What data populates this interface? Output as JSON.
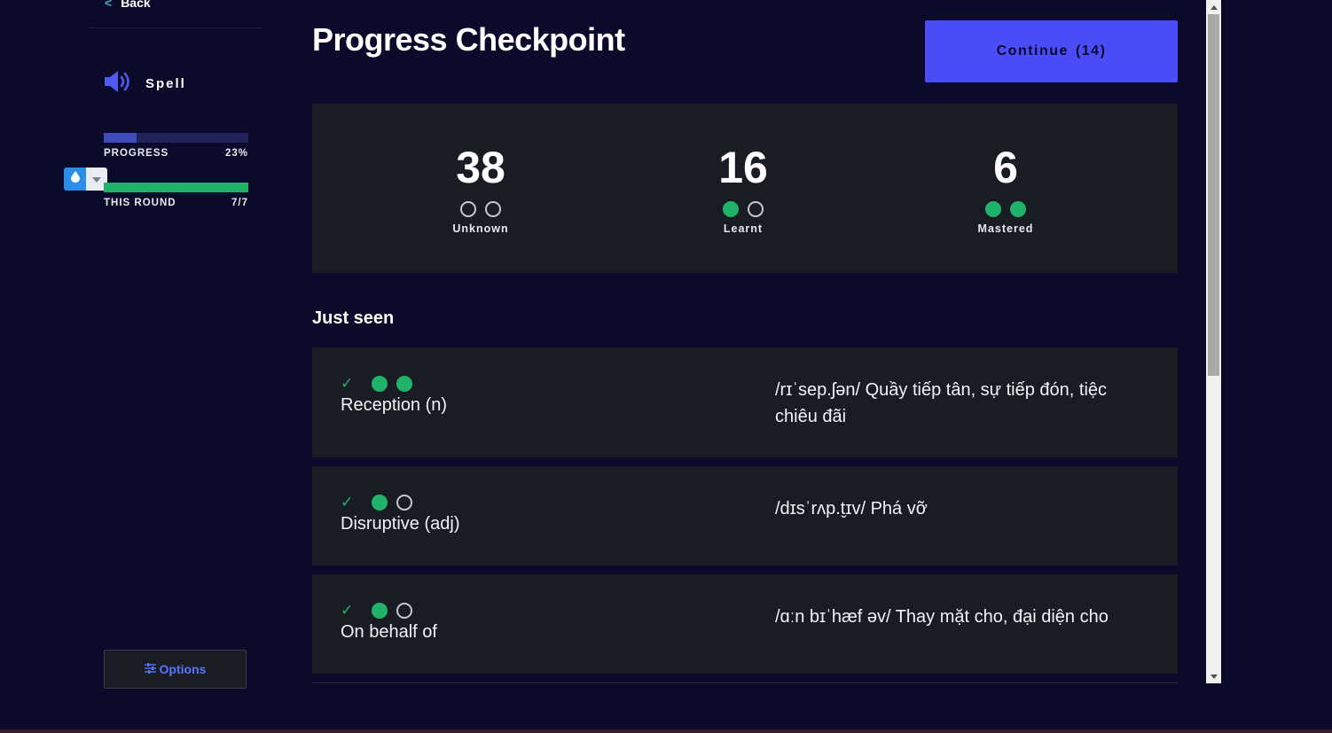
{
  "sidebar": {
    "back_label": "Back",
    "mode_label": "Spell",
    "progress": {
      "label": "PROGRESS",
      "value_text": "23%",
      "fraction": 0.23,
      "color": "#3e4bb8"
    },
    "round": {
      "label": "THIS ROUND",
      "value_text": "7/7",
      "fraction": 1.0,
      "color": "#21b36a"
    },
    "options_label": "Options"
  },
  "header": {
    "title": "Progress Checkpoint",
    "continue_label": "Continue",
    "continue_count": "(14)"
  },
  "stats": [
    {
      "number": "38",
      "label": "Unknown",
      "filled_dots": 0
    },
    {
      "number": "16",
      "label": "Learnt",
      "filled_dots": 1
    },
    {
      "number": "6",
      "label": "Mastered",
      "filled_dots": 2
    }
  ],
  "just_seen": {
    "title": "Just seen",
    "items": [
      {
        "term": "Reception (n)",
        "definition": "/rɪˈsep.ʃən/ Quầy tiếp tân, sự tiếp đón, tiệc chiêu đãi",
        "filled_dots": 2
      },
      {
        "term": "Disruptive (adj)",
        "definition": "/dɪsˈrʌp.t̬ɪv/ Phá vỡ",
        "filled_dots": 1
      },
      {
        "term": "On behalf of",
        "definition": "/ɑːn bɪˈhæf əv/ Thay mặt cho, đại diện cho",
        "filled_dots": 1
      }
    ]
  },
  "colors": {
    "background": "#0b0a2a",
    "panel": "#1a1c24",
    "accent": "#4a4cf7",
    "success": "#21b36a"
  }
}
